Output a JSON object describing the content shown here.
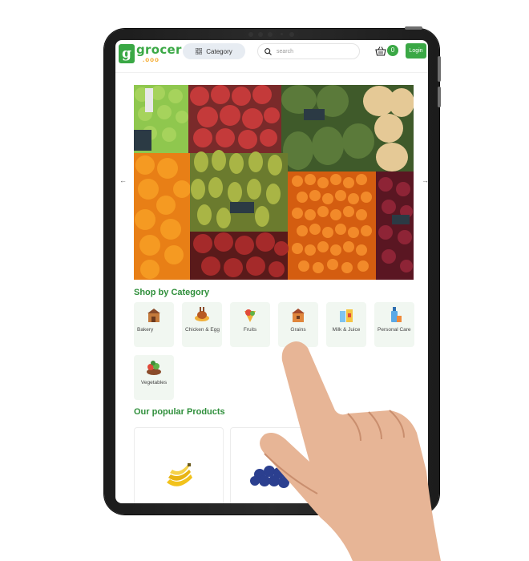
{
  "header": {
    "logo_letter": "g",
    "logo_word": "grocer",
    "logo_sub": ".ooo",
    "category_label": "Category",
    "search_placeholder": "search",
    "cart_count": "0",
    "login_label": "Login"
  },
  "banner": {
    "prev_icon": "arrow-left-icon",
    "next_icon": "arrow-right-icon"
  },
  "categories_section": {
    "title": "Shop by Category",
    "items": [
      {
        "label": "Bakery",
        "icon": "bakery-icon"
      },
      {
        "label": "Chicken & Egg",
        "icon": "chicken-icon"
      },
      {
        "label": "Fruits",
        "icon": "fruits-icon"
      },
      {
        "label": "Grains",
        "icon": "grains-icon"
      },
      {
        "label": "Milk & Juice",
        "icon": "milk-juice-icon"
      },
      {
        "label": "Personal Care",
        "icon": "personal-care-icon"
      },
      {
        "label": "Vegetables",
        "icon": "vegetables-icon"
      }
    ]
  },
  "products_section": {
    "title": "Our popular Products",
    "items": [
      {
        "image": "banana-image"
      },
      {
        "image": "blueberries-image"
      }
    ]
  },
  "colors": {
    "brand_green": "#3aa845",
    "title_green": "#2f8f3b",
    "card_bg": "#f1f7f1",
    "accent_orange": "#f5a623"
  }
}
